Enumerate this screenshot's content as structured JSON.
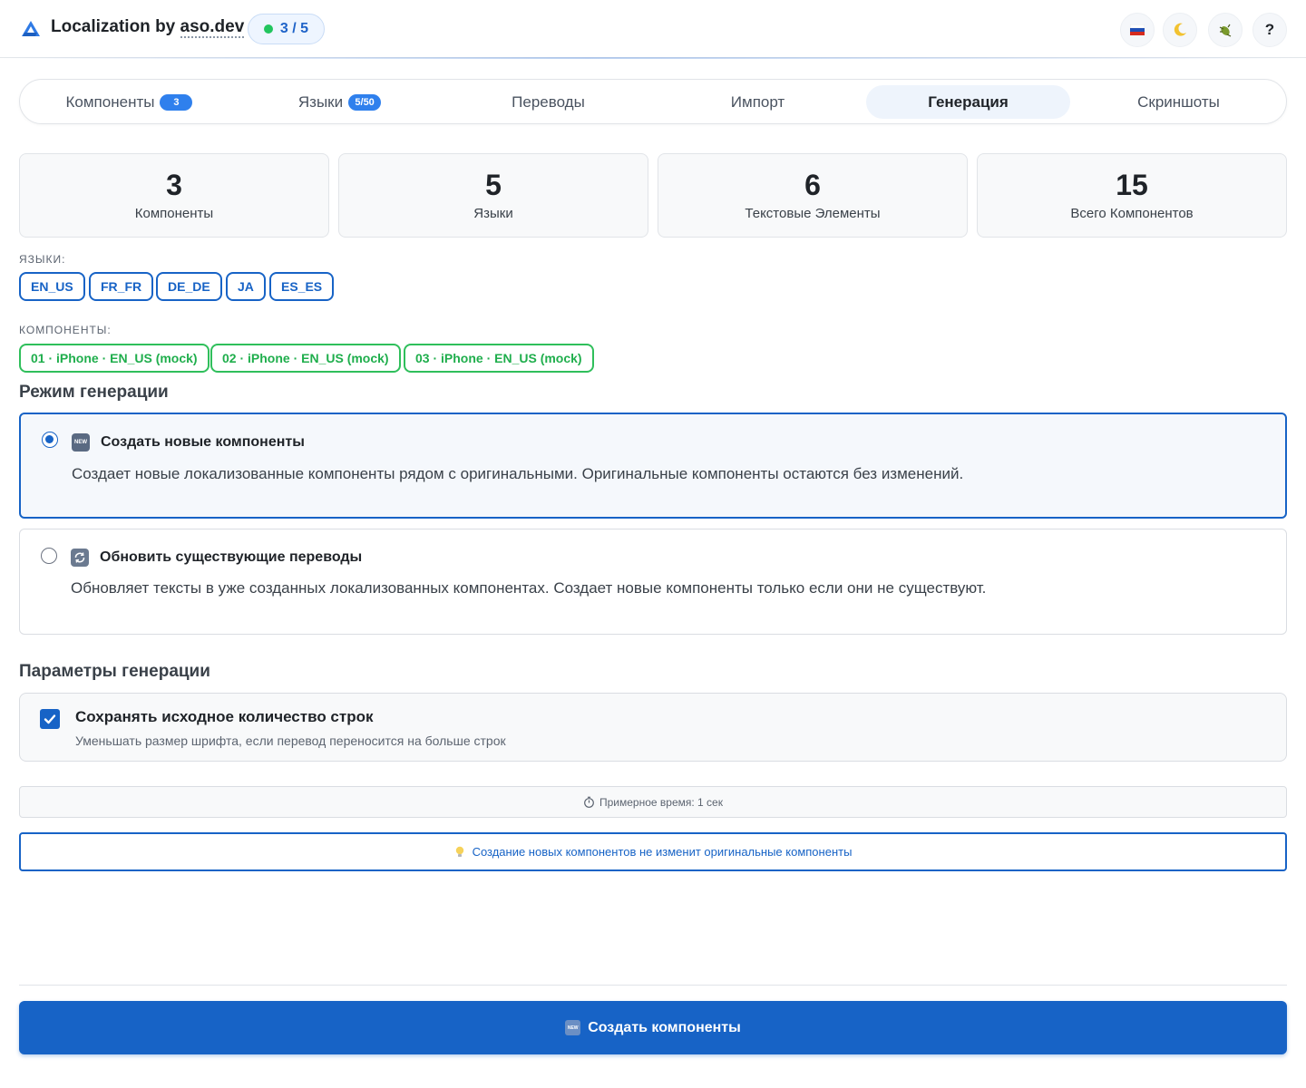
{
  "header": {
    "title_prefix": "Localization by ",
    "brand": "aso.dev",
    "progress": "3 / 5",
    "buttons": [
      {
        "name": "language-flag-ru",
        "icon": "russia-flag-icon",
        "glyph": "🇷🇺"
      },
      {
        "name": "theme-toggle",
        "icon": "moon-icon",
        "glyph": "🌙"
      },
      {
        "name": "debug",
        "icon": "bug-icon",
        "glyph": "🐛"
      },
      {
        "name": "help",
        "icon": "question-icon",
        "glyph": "?"
      }
    ]
  },
  "tabs": [
    {
      "label": "Компоненты",
      "badge": "3",
      "active": false
    },
    {
      "label": "Языки",
      "badge": "5/50",
      "active": false
    },
    {
      "label": "Переводы",
      "badge": "",
      "active": false
    },
    {
      "label": "Импорт",
      "badge": "",
      "active": false
    },
    {
      "label": "Генерация",
      "badge": "",
      "active": true
    },
    {
      "label": "Скриншоты",
      "badge": "",
      "active": false
    }
  ],
  "stats": [
    {
      "value": "3",
      "label": "Компоненты"
    },
    {
      "value": "5",
      "label": "Языки"
    },
    {
      "value": "6",
      "label": "Текстовые Элементы"
    },
    {
      "value": "15",
      "label": "Всего Компонентов"
    }
  ],
  "languages": {
    "label": "ЯЗЫКИ:",
    "items": [
      "EN_US",
      "FR_FR",
      "DE_DE",
      "JA",
      "ES_ES"
    ]
  },
  "components": {
    "label": "КОМПОНЕНТЫ:",
    "items": [
      "01 · iPhone · EN_US (mock)",
      "02 · iPhone · EN_US (mock)",
      "03 · iPhone · EN_US (mock)"
    ]
  },
  "mode": {
    "heading": "Режим генерации",
    "options": [
      {
        "title": "Создать новые компоненты",
        "desc": "Создает новые локализованные компоненты рядом с оригинальными. Оригинальные компоненты остаются без изменений.",
        "selected": true,
        "icon": "new-icon",
        "icon_text": "NEW"
      },
      {
        "title": "Обновить существующие переводы",
        "desc": "Обновляет тексты в уже созданных локализованных компонентах. Создает новые компоненты только если они не существуют.",
        "selected": false,
        "icon": "refresh-icon",
        "icon_text": "🔄"
      }
    ]
  },
  "params": {
    "heading": "Параметры генерации",
    "keep_lines": {
      "title": "Сохранять исходное количество строк",
      "desc": "Уменьшать размер шрифта, если перевод переносится на больше строк",
      "checked": true
    }
  },
  "estimate": {
    "icon": "stopwatch-icon",
    "text": "Примерное время: 1 сек"
  },
  "hint": {
    "icon": "lightbulb-icon",
    "text": "Создание новых компонентов не изменит оригинальные компоненты"
  },
  "primary": {
    "label": "Создать компоненты",
    "icon": "new-icon",
    "icon_text": "NEW"
  },
  "colors": {
    "accent": "#1763c6",
    "success": "#2fbf5b",
    "badge": "#2f80ed"
  }
}
